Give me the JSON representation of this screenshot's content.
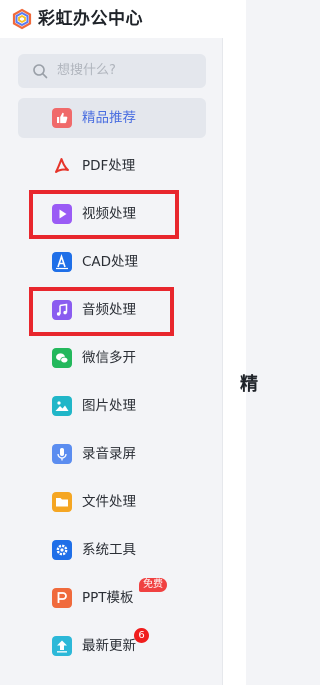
{
  "app": {
    "title": "彩虹办公中心"
  },
  "search": {
    "placeholder": "想搜什么?"
  },
  "menu": [
    {
      "key": "featured",
      "label": "精品推荐",
      "icon": "thumbs-up-icon",
      "color": "#f06a6a",
      "active": true
    },
    {
      "key": "pdf",
      "label": "PDF处理",
      "icon": "acrobat-icon",
      "color": "#e6342a"
    },
    {
      "key": "video",
      "label": "视频处理",
      "icon": "play-icon",
      "color": "#9a5bf5"
    },
    {
      "key": "cad",
      "label": "CAD处理",
      "icon": "cad-ruler-icon",
      "color": "#1f6fe8"
    },
    {
      "key": "audio",
      "label": "音频处理",
      "icon": "music-note-icon",
      "color": "#8a5cf0"
    },
    {
      "key": "wechat",
      "label": "微信多开",
      "icon": "wechat-icon",
      "color": "#23b85c"
    },
    {
      "key": "image",
      "label": "图片处理",
      "icon": "picture-icon",
      "color": "#20b6c8"
    },
    {
      "key": "record",
      "label": "录音录屏",
      "icon": "microphone-icon",
      "color": "#5b8df0"
    },
    {
      "key": "file",
      "label": "文件处理",
      "icon": "folder-icon",
      "color": "#f5a623"
    },
    {
      "key": "system",
      "label": "系统工具",
      "icon": "gear-icon",
      "color": "#1f6fe8"
    },
    {
      "key": "ppt",
      "label": "PPT模板",
      "icon": "ppt-icon",
      "color": "#f06a3c",
      "badge": "免费"
    },
    {
      "key": "update",
      "label": "最新更新",
      "icon": "upload-arrow-icon",
      "color": "#2cb8d8",
      "count": "6"
    }
  ],
  "content": {
    "peek_text": "精"
  }
}
